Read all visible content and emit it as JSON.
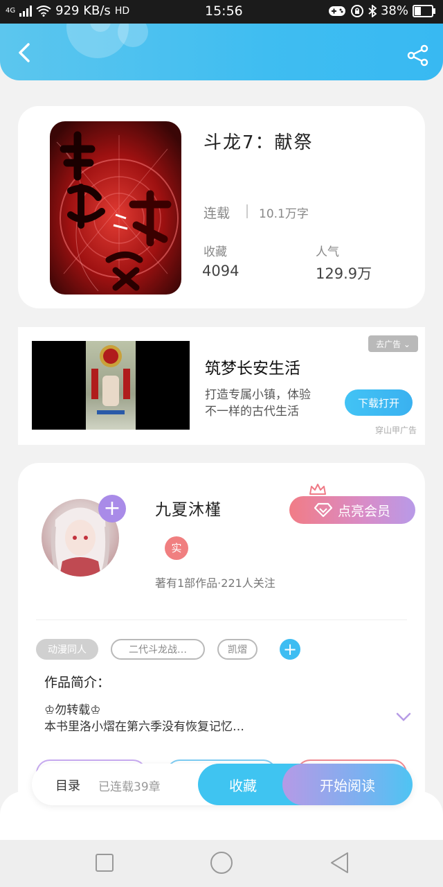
{
  "status_bar": {
    "network": "4G",
    "speed": "929 KB/s",
    "hd": "HD",
    "time": "15:56",
    "battery": "38%"
  },
  "header": {
    "back_icon": "chevron-left-icon",
    "share_icon": "share-icon"
  },
  "book": {
    "title": "斗龙7：献祭",
    "status": "连载",
    "word_count": "10.1万字",
    "favorites_label": "收藏",
    "favorites_value": "4094",
    "popularity_label": "人气",
    "popularity_value": "129.9万"
  },
  "ad": {
    "close_label": "去广告 ⌄",
    "title": "筑梦长安生活",
    "desc_line1": "打造专属小镇，体验",
    "desc_line2": "不一样的古代生活",
    "cta": "下载打开",
    "source": "穿山甲广告"
  },
  "author": {
    "name": "九夏沐槿",
    "real_badge": "实",
    "stats": "著有1部作品·221人关注",
    "vip_label": "点亮会员"
  },
  "tags": {
    "items": [
      "动漫同人",
      "二代斗龙战…",
      "凯熠"
    ]
  },
  "intro": {
    "label": "作品简介：",
    "line1": "♔勿转载♔",
    "line2": "本书里洛小熠在第六季没有恢复记忆…"
  },
  "bottom_bar": {
    "toc_label": "目录",
    "chapters": "已连载39章",
    "collect": "收藏",
    "read": "开始阅读"
  },
  "colors": {
    "accent": "#3fbdf1",
    "vip_gradient_start": "#f17c86",
    "vip_gradient_end": "#b89ae8"
  }
}
